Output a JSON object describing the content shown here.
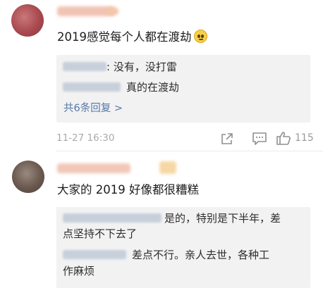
{
  "comments": [
    {
      "text": "2019感觉每个人都在渡劫",
      "emoji": "sad-face-emoji",
      "replies": [
        {
          "text": ": 没有，没打雷"
        },
        {
          "text": "真的在渡劫"
        }
      ],
      "more_replies": "共6条回复 >",
      "timestamp": "11-27 16:30",
      "like_count": "115"
    },
    {
      "text": "大家的 2019 好像都很糟糕",
      "replies": [
        {
          "line1": "是的，特别是下半年，差",
          "line2": "点坚持不下去了"
        },
        {
          "line1": "差点不行。亲人去世，各种工",
          "line2": "作麻烦"
        }
      ]
    }
  ],
  "colors": {
    "reply_bg": "#f2f2f2",
    "link_blue": "#5578a8",
    "meta_gray": "#aaaaaa"
  }
}
